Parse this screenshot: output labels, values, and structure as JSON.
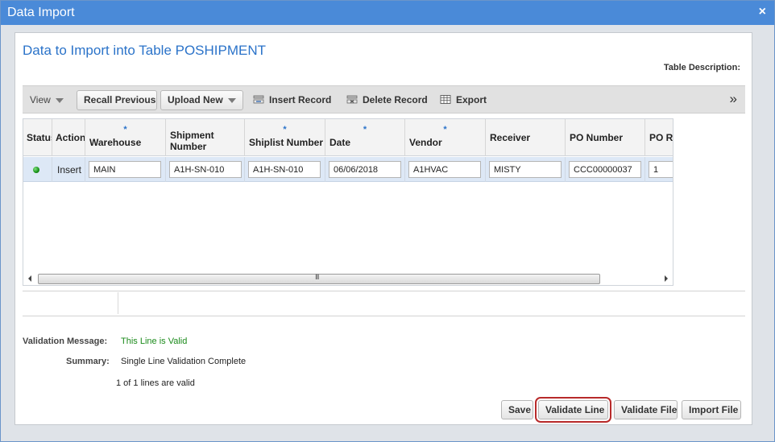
{
  "window": {
    "title": "Data Import",
    "close_glyph": "×"
  },
  "page": {
    "heading": "Data to Import into Table POSHIPMENT",
    "table_description_label": "Table Description:"
  },
  "toolbar": {
    "view_label": "View",
    "recall_previous": "Recall Previous",
    "upload_new": "Upload New",
    "insert_record": "Insert Record",
    "delete_record": "Delete Record",
    "export": "Export",
    "more_glyph": "»"
  },
  "grid": {
    "required_marker": "*",
    "columns": [
      {
        "label": "Status",
        "required": false
      },
      {
        "label": "Action",
        "required": false
      },
      {
        "label": "Warehouse",
        "required": true
      },
      {
        "label": "Shipment Number",
        "required": false
      },
      {
        "label": "Shiplist Number",
        "required": true
      },
      {
        "label": "Date",
        "required": true
      },
      {
        "label": "Vendor",
        "required": true
      },
      {
        "label": "Receiver",
        "required": false
      },
      {
        "label": "PO Number",
        "required": false
      },
      {
        "label": "PO Re",
        "required": false
      }
    ],
    "row": {
      "status_color": "#179117",
      "action": "Insert",
      "warehouse": "MAIN",
      "shipment_number": "A1H-SN-010",
      "shiplist_number": "A1H-SN-010",
      "date": "06/06/2018",
      "vendor": "A1HVAC",
      "receiver": "MISTY",
      "po_number": "CCC00000037",
      "po_re": "1"
    },
    "scroll_grip": "III"
  },
  "validation": {
    "message_label": "Validation Message:",
    "message_text": "This Line is Valid",
    "summary_label": "Summary:",
    "summary_text": "Single Line Validation Complete",
    "count_text": "1 of 1 lines are valid"
  },
  "buttons": {
    "save": "Save",
    "validate_line": "Validate Line",
    "validate_file": "Validate File",
    "import_file": "Import File"
  },
  "colors": {
    "titlebar": "#4a8ad8",
    "heading": "#2b73c9",
    "valid_text": "#1a8a1a",
    "selected_row": "#dde8f6",
    "highlight_outline": "#b82a2a"
  }
}
